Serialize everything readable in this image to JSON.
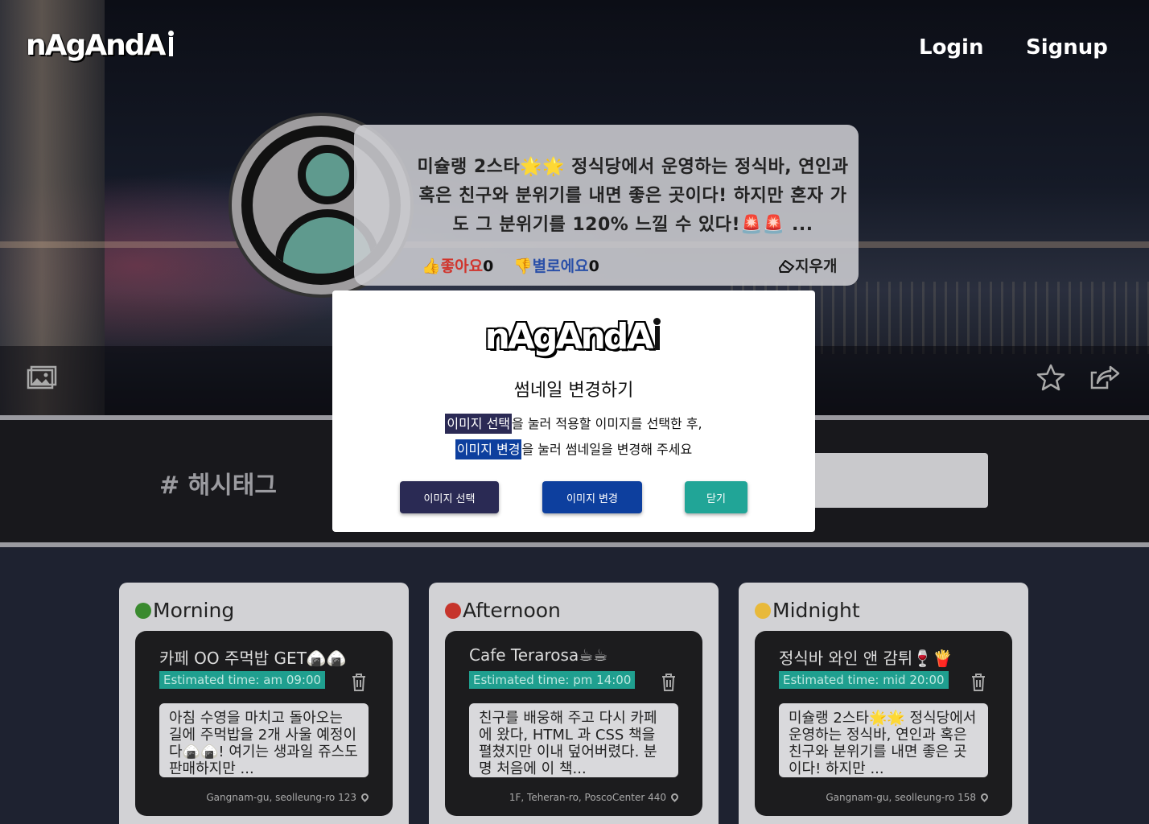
{
  "header": {
    "logo": "nAgAndA",
    "login_label": "Login",
    "signup_label": "Signup"
  },
  "profile": {
    "description": "미슐랭 2스타🌟🌟 정식당에서 운영하는 정식바, 연인과 혹은 친구와 분위기를 내면 좋은 곳이다! 하지만 혼자 가도 그 분위기를 120% 느낄 수 있다!🚨🚨 ...",
    "like_label": "👍좋아요",
    "like_count": "0",
    "dislike_label": "👎별로에요",
    "dislike_count": "0",
    "erase_label": "지우개"
  },
  "hashtag": {
    "label": "# 해시태그",
    "input_value": ""
  },
  "cards": [
    {
      "title": "Morning",
      "emoji_color": "#3a8a2f",
      "place": "카페 OO 주먹밥 GET🍙🍙",
      "time": "Estimated time: am 09:00",
      "note": "아침 수영을 마치고 돌아오는 길에 주먹밥을 2개 사울 예정이다🍙🍙! 여기는 생과일 쥬스도 판매하지만 ...",
      "address": "Gangnam-gu, seolleung-ro 123"
    },
    {
      "title": "Afternoon",
      "emoji_color": "#c6352c",
      "place": "Cafe Terarosa☕☕",
      "time": "Estimated time: pm 14:00",
      "note": "친구를 배웅해 주고 다시 카페에 왔다, HTML 과 CSS 책을 펼쳤지만 이내 덮어버렸다. 분명 처음에 이 책...",
      "address": "1F, Teheran-ro, PoscoCenter 440"
    },
    {
      "title": "Midnight",
      "emoji_color": "#e8b93a",
      "place": "정식바 와인 앤 감튀🍷🍟",
      "time": "Estimated time: mid 20:00",
      "note": "미슐랭 2스타🌟🌟 정식당에서 운영하는 정식바, 연인과 혹은 친구와 분위기를 내면 좋은 곳이다! 하지만 ...",
      "address": "Gangnam-gu, seolleung-ro 158"
    }
  ],
  "modal": {
    "logo": "nAgAndA",
    "title": "썸네일 변경하기",
    "line1_highlight": "이미지 선택",
    "line1_rest": "을 눌러 적용할 이미지를 선택한 후,",
    "line2_highlight": "이미지 변경",
    "line2_rest": "을 눌러 썸네일을 변경해 주세요",
    "select_button": "이미지 선택",
    "change_button": "이미지 변경",
    "close_button": "닫기"
  },
  "colors": {
    "accent_teal": "#21a597",
    "accent_navy": "#2a2a54",
    "accent_blue": "#0d3f9e"
  }
}
